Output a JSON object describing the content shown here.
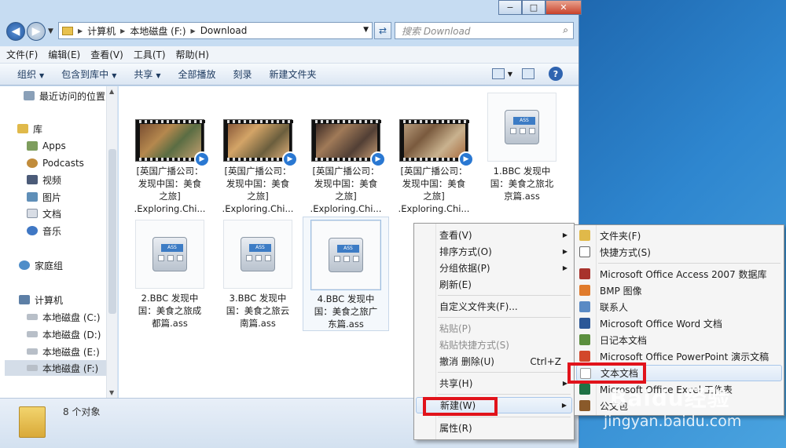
{
  "window": {
    "controls": {
      "minimize": "−",
      "maximize": "□",
      "close": "✕"
    },
    "nav": {
      "back_icon": "◀",
      "forward_icon": "▶",
      "dropdown_icon": "▼"
    },
    "breadcrumb": [
      "计算机",
      "本地磁盘 (F:)",
      "Download"
    ],
    "search_placeholder": "搜索 Download",
    "search_icon": "⌕",
    "refresh_icon": "⇄"
  },
  "menubar": [
    "文件(F)",
    "编辑(E)",
    "查看(V)",
    "工具(T)",
    "帮助(H)"
  ],
  "toolbar": {
    "organize": "组织",
    "include_library": "包含到库中",
    "share": "共享",
    "play_all": "全部播放",
    "burn": "刻录",
    "new_folder": "新建文件夹",
    "help": "?"
  },
  "sidebar": {
    "items": [
      {
        "label": "最近访问的位置",
        "icon": "recent-places-icon"
      },
      {
        "label": "库",
        "icon": "library-icon"
      },
      {
        "label": "Apps",
        "icon": "apps-icon"
      },
      {
        "label": "Podcasts",
        "icon": "podcast-icon"
      },
      {
        "label": "视频",
        "icon": "video-icon"
      },
      {
        "label": "图片",
        "icon": "picture-icon"
      },
      {
        "label": "文档",
        "icon": "document-icon"
      },
      {
        "label": "音乐",
        "icon": "music-icon"
      },
      {
        "label": "家庭组",
        "icon": "homegroup-icon"
      },
      {
        "label": "计算机",
        "icon": "computer-icon"
      },
      {
        "label": "本地磁盘 (C:)",
        "icon": "drive-icon"
      },
      {
        "label": "本地磁盘 (D:)",
        "icon": "drive-icon"
      },
      {
        "label": "本地磁盘 (E:)",
        "icon": "drive-icon"
      },
      {
        "label": "本地磁盘 (F:)",
        "icon": "drive-icon"
      }
    ]
  },
  "files": [
    {
      "name": "[英国广播公司：发现中国：美食之旅].Exploring.Chi...",
      "lines": [
        "[英国广播公司：",
        "发现中国：美食",
        "之旅]",
        ".Exploring.Chi..."
      ],
      "type": "video"
    },
    {
      "name": "[英国广播公司：发现中国：美食之旅].Exploring.Chi...",
      "lines": [
        "[英国广播公司：",
        "发现中国：美食",
        "之旅]",
        ".Exploring.Chi..."
      ],
      "type": "video"
    },
    {
      "name": "[英国广播公司：发现中国：美食之旅].Exploring.Chi...",
      "lines": [
        "[英国广播公司：",
        "发现中国：美食",
        "之旅]",
        ".Exploring.Chi..."
      ],
      "type": "video"
    },
    {
      "name": "[英国广播公司：发现中国：美食之旅].Exploring.Chi...",
      "lines": [
        "[英国广播公司：",
        "发现中国：美食",
        "之旅]",
        ".Exploring.Chi..."
      ],
      "type": "video"
    },
    {
      "name": "1.BBC 发现中国：美食之旅北京篇.ass",
      "lines": [
        "1.BBC 发现中",
        "国：美食之旅北",
        "京篇.ass"
      ],
      "type": "ass"
    },
    {
      "name": "2.BBC 发现中国：美食之旅成都篇.ass",
      "lines": [
        "2.BBC 发现中",
        "国：美食之旅成",
        "都篇.ass"
      ],
      "type": "ass"
    },
    {
      "name": "3.BBC 发现中国：美食之旅云南篇.ass",
      "lines": [
        "3.BBC 发现中",
        "国：美食之旅云",
        "南篇.ass"
      ],
      "type": "ass"
    },
    {
      "name": "4.BBC 发现中国：美食之旅广东篇.ass",
      "lines": [
        "4.BBC 发现中",
        "国：美食之旅广",
        "东篇.ass"
      ],
      "type": "ass"
    }
  ],
  "ass_tag": "ASS",
  "status": {
    "count": "8 个对象"
  },
  "context_menu": {
    "items": [
      {
        "label": "查看(V)",
        "submenu": true
      },
      {
        "label": "排序方式(O)",
        "submenu": true
      },
      {
        "label": "分组依据(P)",
        "submenu": true
      },
      {
        "label": "刷新(E)"
      },
      {
        "label": "自定义文件夹(F)..."
      },
      {
        "label": "粘贴(P)",
        "disabled": true
      },
      {
        "label": "粘贴快捷方式(S)",
        "disabled": true
      },
      {
        "label": "撤消 删除(U)",
        "accelerator": "Ctrl+Z"
      },
      {
        "label": "共享(H)",
        "submenu": true
      },
      {
        "label": "新建(W)",
        "submenu": true,
        "highlighted": true
      },
      {
        "label": "属性(R)"
      }
    ]
  },
  "submenu_new": {
    "items": [
      {
        "label": "文件夹(F)",
        "icon": "folder-icon"
      },
      {
        "label": "快捷方式(S)",
        "icon": "shortcut-icon"
      },
      {
        "label": "Microsoft Office Access 2007 数据库",
        "icon": "access-icon"
      },
      {
        "label": "BMP 图像",
        "icon": "bmp-icon"
      },
      {
        "label": "联系人",
        "icon": "contact-icon"
      },
      {
        "label": "Microsoft Office Word 文档",
        "icon": "word-icon"
      },
      {
        "label": "日记本文档",
        "icon": "journal-icon"
      },
      {
        "label": "Microsoft Office PowerPoint 演示文稿",
        "icon": "powerpoint-icon"
      },
      {
        "label": "文本文档",
        "icon": "text-document-icon",
        "highlighted": true
      },
      {
        "label": "Microsoft Office Excel 工作表",
        "icon": "excel-icon"
      },
      {
        "label": "公文包",
        "icon": "briefcase-icon"
      }
    ]
  },
  "watermark": {
    "brand": "Baidu经验",
    "url": "jingyan.baidu.com"
  },
  "colors": {
    "highlight_red": "#e1131b",
    "accent_blue": "#2f64b0"
  }
}
